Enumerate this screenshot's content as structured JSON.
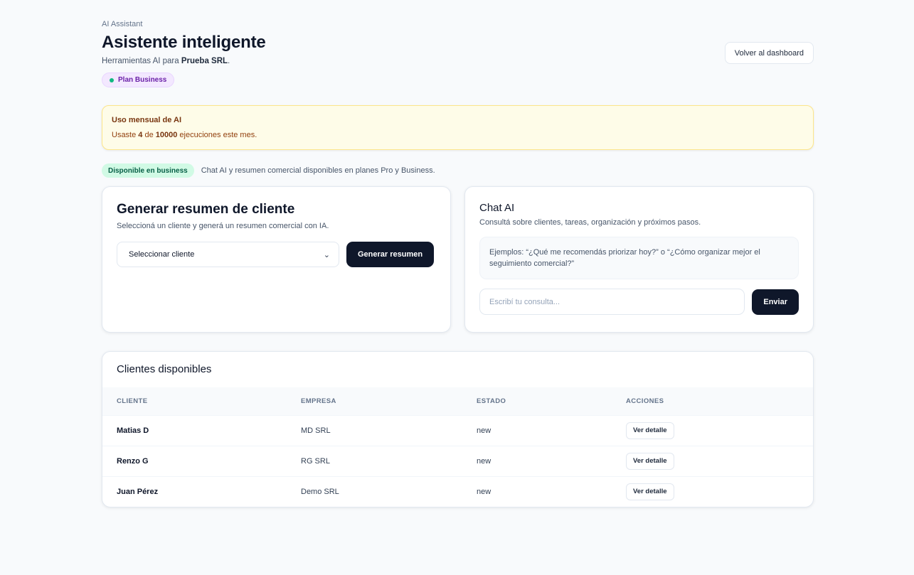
{
  "header": {
    "eyebrow": "AI Assistant",
    "title": "Asistente inteligente",
    "subtitle_prefix": "Herramientas AI para ",
    "company": "Prueba SRL",
    "subtitle_suffix": ".",
    "plan_badge": "Plan Business",
    "back_button": "Volver al dashboard"
  },
  "usage": {
    "title": "Uso mensual de AI",
    "text_prefix": "Usaste ",
    "used": "4",
    "text_mid": " de ",
    "limit": "10000",
    "text_suffix": " ejecuciones este mes."
  },
  "availability": {
    "badge": "Disponible en business",
    "text": "Chat AI y resumen comercial disponibles en planes Pro y Business."
  },
  "summary_card": {
    "title": "Generar resumen de cliente",
    "subtitle": "Seleccioná un cliente y generá un resumen comercial con IA.",
    "select_value": "Seleccionar cliente",
    "button": "Generar resumen"
  },
  "chat_card": {
    "title": "Chat AI",
    "subtitle": "Consultá sobre clientes, tareas, organización y próximos pasos.",
    "examples": "Ejemplos: “¿Qué me recomendás priorizar hoy?” o “¿Cómo organizar mejor el seguimiento comercial?”",
    "input_placeholder": "Escribí tu consulta...",
    "button": "Enviar"
  },
  "clients": {
    "title": "Clientes disponibles",
    "columns": [
      "CLIENTE",
      "EMPRESA",
      "ESTADO",
      "ACCIONES"
    ],
    "rows": [
      {
        "cliente": "Matias D",
        "empresa": "MD SRL",
        "estado": "new",
        "accion": "Ver detalle"
      },
      {
        "cliente": "Renzo G",
        "empresa": "RG SRL",
        "estado": "new",
        "accion": "Ver detalle"
      },
      {
        "cliente": "Juan Pérez",
        "empresa": "Demo SRL",
        "estado": "new",
        "accion": "Ver detalle"
      }
    ]
  },
  "colors": {
    "primary_dark": "#0f172a",
    "plan_badge_bg": "#f3e8ff",
    "plan_badge_text": "#6b21a8",
    "usage_bg": "#fefce8",
    "usage_border": "#fde68a",
    "avail_badge_bg": "#d1fae5",
    "status_dot": "#10b981"
  }
}
